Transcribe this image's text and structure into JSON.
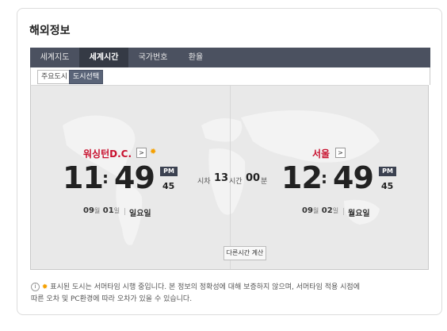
{
  "section_title": "해외정보",
  "tabs": [
    {
      "label": "세계지도",
      "active": false
    },
    {
      "label": "세계시간",
      "active": true
    },
    {
      "label": "국가번호",
      "active": false
    },
    {
      "label": "환율",
      "active": false
    }
  ],
  "subtabs": [
    {
      "label": "주요도시",
      "active": false
    },
    {
      "label": "도시선택",
      "active": true
    }
  ],
  "left": {
    "city": "워싱턴D.C.",
    "arrow": ">",
    "daylight_icon": "sun-icon",
    "hour": "11",
    "minute": "49",
    "ampm": "PM",
    "second": "45",
    "month": "09",
    "month_unit": "월",
    "day": "01",
    "day_unit": "일",
    "weekday": "일요일"
  },
  "right": {
    "city": "서울",
    "arrow": ">",
    "hour": "12",
    "minute": "49",
    "ampm": "PM",
    "second": "45",
    "month": "09",
    "month_unit": "월",
    "day": "02",
    "day_unit": "일",
    "weekday": "월요일"
  },
  "diff": {
    "label": "시차",
    "hours": "13",
    "hours_unit": "시간",
    "minutes": "00",
    "minutes_unit": "분"
  },
  "calc_button": "다른시간 계산",
  "notice": {
    "line1": "표시된 도시는 서머타임 시행 중입니다. 본 정보의 정확성에 대해 보증하지 않으며, 서머타임 적용 시점에",
    "line2": "따른 오차 및 PC환경에 따라 오차가 있을 수 있습니다."
  },
  "colors": {
    "city_red": "#c8102e",
    "tab_bar": "#4b5160",
    "tab_active": "#353a45",
    "sun": "#f5a000"
  }
}
